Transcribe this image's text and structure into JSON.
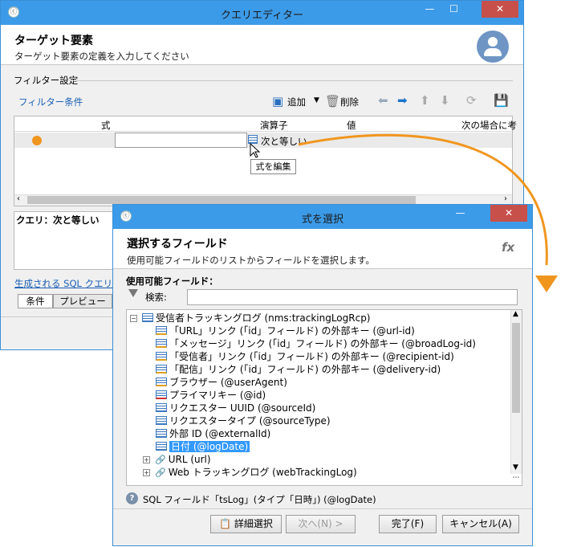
{
  "main_window": {
    "title": "クエリエディター",
    "header_title": "ターゲット要素",
    "header_subtitle": "ターゲット要素の定義を入力してください",
    "section_label": "フィルター設定",
    "filter_link": "フィルター条件",
    "toolbar": {
      "add_label": "追加",
      "delete_label": "削除"
    },
    "columns": [
      "式",
      "演算子",
      "値",
      "次の場合に考"
    ],
    "row_operator": "次と等しい",
    "tooltip": "式を編集",
    "query_label": "クエリ：次と等しい",
    "sql_link": "生成される SQL クエリ...",
    "tabs": [
      "条件",
      "プレビュー"
    ]
  },
  "dialog": {
    "title": "式を選択",
    "header_title": "選択するフィールド",
    "header_subtitle": "使用可能フィールドのリストからフィールドを選択します。",
    "fx_label": "fx",
    "fields_label": "使用可能フィールド：",
    "search_label": "検索:",
    "search_value": "",
    "tree": [
      {
        "label": "受信者トラッキングログ (nms:trackingLogRcp)",
        "icon": "table-icon",
        "level": 0,
        "expander": "⊟"
      },
      {
        "label": "「URL」リンク (「id」フィールド) の外部キー (@url-id)",
        "icon": "foreign-key-icon",
        "level": 1
      },
      {
        "label": "「メッセージ」リンク (「id」フィールド) の外部キー (@broadLog-id)",
        "icon": "foreign-key-icon",
        "level": 1
      },
      {
        "label": "「受信者」リンク (「id」フィールド) の外部キー (@recipient-id)",
        "icon": "foreign-key-icon",
        "level": 1
      },
      {
        "label": "「配信」リンク (「id」フィールド) の外部キー (@delivery-id)",
        "icon": "foreign-key-icon",
        "level": 1
      },
      {
        "label": "ブラウザー (@userAgent)",
        "icon": "foreign-key-icon",
        "level": 1
      },
      {
        "label": "プライマリキー (@id)",
        "icon": "primary-key-icon",
        "level": 1
      },
      {
        "label": "リクエスター UUID (@sourceId)",
        "icon": "field-icon",
        "level": 1
      },
      {
        "label": "リクエスタータイプ (@sourceType)",
        "icon": "field-icon",
        "level": 1
      },
      {
        "label": "外部 ID (@externalId)",
        "icon": "field-icon",
        "level": 1
      },
      {
        "label": "日付 (@logDate)",
        "icon": "field-icon",
        "level": 1,
        "selected": true
      },
      {
        "label": "URL (url)",
        "icon": "link-icon",
        "level": 1,
        "expander": "⊞"
      },
      {
        "label": "Web トラッキングログ (webTrackingLog)",
        "icon": "link-icon",
        "level": 1,
        "expander": "⊞"
      }
    ],
    "status_text": "SQL フィールド「tsLog」(タイプ「日時」) (@logDate)",
    "buttons": {
      "details": "詳細選択",
      "next": "次へ(N) >",
      "finish": "完了(F)",
      "cancel": "キャンセル(A)"
    }
  },
  "colors": {
    "title_bar": "#3c9be8",
    "close": "#c7504a",
    "arrow": "#f0961e",
    "selection": "#3399ff",
    "link": "#1a5fb4"
  }
}
